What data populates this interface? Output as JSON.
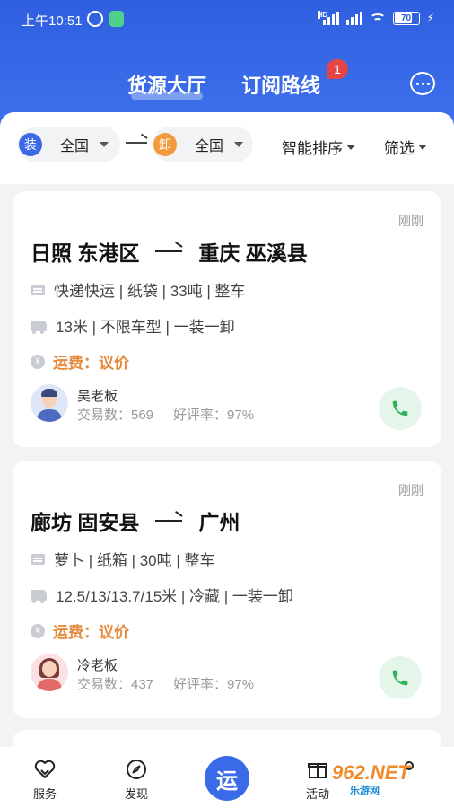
{
  "statusbar": {
    "time": "上午10:51",
    "battery": "70"
  },
  "header": {
    "tab_active": "货源大厅",
    "tab_subscribe": "订阅路线",
    "subscribe_badge": "1"
  },
  "filters": {
    "load_tag": "装",
    "load_value": "全国",
    "unload_tag": "卸",
    "unload_value": "全国",
    "sort_label": "智能排序",
    "filter_label": "筛选"
  },
  "cards": [
    {
      "time": "刚刚",
      "from": "日照 东港区",
      "to": "重庆 巫溪县",
      "cargo": "快递快运 | 纸袋 | 33吨 | 整车",
      "truck": "13米 | 不限车型 | 一装一卸",
      "price": "运费：议价",
      "owner": "吴老板",
      "deals": "交易数：569",
      "rating": "好评率：97%"
    },
    {
      "time": "刚刚",
      "from": "廊坊 固安县",
      "to": "广州",
      "cargo": "萝卜 | 纸箱 | 30吨 | 整车",
      "truck": "12.5/13/13.7/15米 | 冷藏 | 一装一卸",
      "price": "运费：议价",
      "owner": "冷老板",
      "deals": "交易数：437",
      "rating": "好评率：97%"
    }
  ],
  "nav": {
    "service": "服务",
    "discover": "发现",
    "center": "运",
    "activity": "活动"
  },
  "watermark": {
    "main": "962.NET",
    "sub": "乐游网"
  },
  "colors": {
    "brand_blue": "#3a6ae8",
    "price_orange": "#e58a3a",
    "call_green": "#2fb35a"
  }
}
